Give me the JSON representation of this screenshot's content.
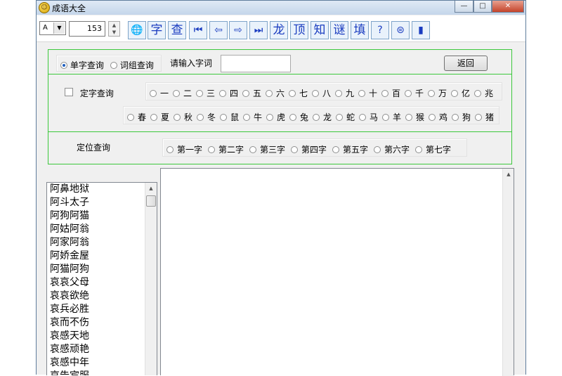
{
  "window": {
    "title": "成语大全",
    "minimize": "—",
    "maximize": "□",
    "close": "✕"
  },
  "toolbar": {
    "letter_select": "A",
    "count": "153",
    "buttons": [
      {
        "name": "globe-button",
        "label": "🌐",
        "icon": "globe-icon"
      },
      {
        "name": "zi-button",
        "label": "字"
      },
      {
        "name": "cha-button",
        "label": "查"
      },
      {
        "name": "first-button",
        "label": "⏮",
        "icon": "first-icon"
      },
      {
        "name": "prev-button",
        "label": "⇦",
        "icon": "left-arrow-icon"
      },
      {
        "name": "next-button",
        "label": "⇨",
        "icon": "right-arrow-icon"
      },
      {
        "name": "last-button",
        "label": "⏭",
        "icon": "last-icon"
      },
      {
        "name": "long-button",
        "label": "龙"
      },
      {
        "name": "ding-button",
        "label": "顶"
      },
      {
        "name": "zhi-button",
        "label": "知"
      },
      {
        "name": "mi-button",
        "label": "谜"
      },
      {
        "name": "tian-button",
        "label": "填"
      },
      {
        "name": "help-button",
        "label": "?",
        "icon": "help-icon"
      },
      {
        "name": "print-button",
        "label": "⊜",
        "icon": "print-icon"
      },
      {
        "name": "exit-button",
        "label": "▮",
        "icon": "door-icon"
      }
    ]
  },
  "query": {
    "mode_single": "单字查询",
    "mode_phrase": "词组查询",
    "input_label": "请输入字词",
    "input_value": "",
    "return_button": "返回",
    "fixed_char_label": "定字查询",
    "numbers": [
      "一",
      "二",
      "三",
      "四",
      "五",
      "六",
      "七",
      "八",
      "九",
      "十",
      "百",
      "千",
      "万",
      "亿",
      "兆"
    ],
    "zodiac": [
      "春",
      "夏",
      "秋",
      "冬",
      "鼠",
      "牛",
      "虎",
      "兔",
      "龙",
      "蛇",
      "马",
      "羊",
      "猴",
      "鸡",
      "狗",
      "猪"
    ],
    "position_label": "定位查询",
    "positions": [
      "第一字",
      "第二字",
      "第三字",
      "第四字",
      "第五字",
      "第六字",
      "第七字"
    ]
  },
  "idioms": [
    "阿鼻地狱",
    "阿斗太子",
    "阿狗阿猫",
    "阿姑阿翁",
    "阿家阿翁",
    "阿娇金屋",
    "阿猫阿狗",
    "哀哀父母",
    "哀哀欲绝",
    "哀兵必胜",
    "哀而不伤",
    "哀感天地",
    "哀感顽艳",
    "哀感中年",
    "哀告宾服"
  ]
}
